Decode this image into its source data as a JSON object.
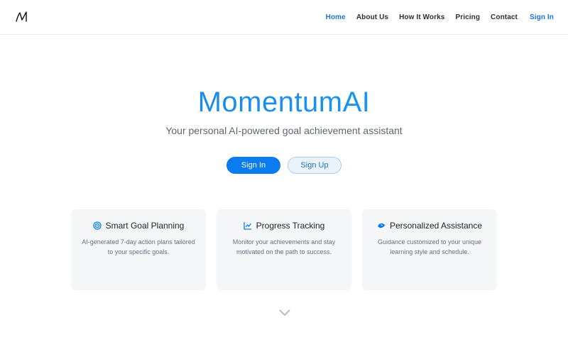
{
  "nav": {
    "logo_icon": "momentum-logo-icon",
    "items": [
      {
        "label": "Home",
        "active": true
      },
      {
        "label": "About Us"
      },
      {
        "label": "How It Works"
      },
      {
        "label": "Pricing"
      },
      {
        "label": "Contact"
      }
    ],
    "signin_label": "Sign In"
  },
  "hero": {
    "title": "MomentumAI",
    "tagline": "Your personal AI-powered goal achievement assistant",
    "signin_button": "Sign In",
    "signup_button": "Sign Up"
  },
  "features": [
    {
      "icon": "target-icon",
      "title": "Smart Goal Planning",
      "description": "AI-generated 7-day action plans tailored to your specific goals."
    },
    {
      "icon": "chart-line-icon",
      "title": "Progress Tracking",
      "description": "Monitor your achievements and stay motivated on the path to success."
    },
    {
      "icon": "hands-helping-icon",
      "title": "Personalized Assistance",
      "description": "Guidance customized to your unique learning style and schedule."
    }
  ],
  "colors": {
    "accent": "#0a7cf0",
    "nav_active": "#1a73c7",
    "card_bg": "#f5f6f8"
  }
}
